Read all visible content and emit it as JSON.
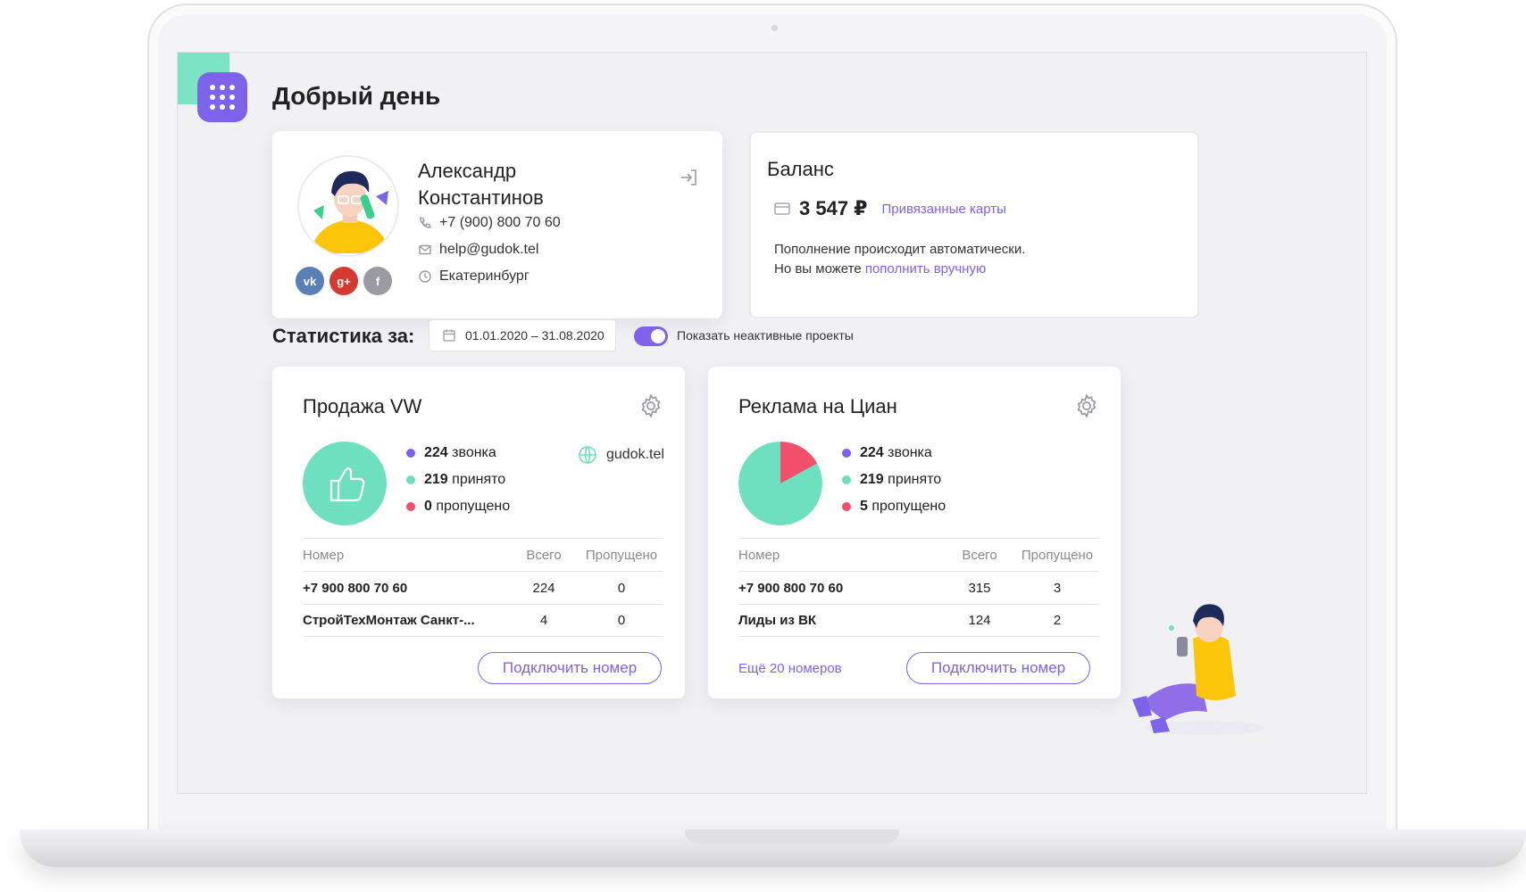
{
  "greeting": "Добрый день",
  "profile": {
    "name_line1": "Александр",
    "name_line2": "Константинов",
    "phone": "+7 (900) 800 70 60",
    "email": "help@gudok.tel",
    "city": "Екатеринбург",
    "socials": [
      {
        "icon": "vk-icon",
        "label": "vk",
        "color": "#5a7fb6"
      },
      {
        "icon": "google-plus-icon",
        "label": "g+",
        "color": "#d23a32"
      },
      {
        "icon": "facebook-icon",
        "label": "f",
        "color": "#9a9aa2"
      }
    ]
  },
  "balance": {
    "title": "Баланс",
    "amount": "3 547 ₽",
    "cards_link": "Привязанные карты",
    "text_line1": "Пополнение происходит автоматически.",
    "text_line2_prefix": "Но вы можете ",
    "text_line2_link": "пополнить вручную"
  },
  "stats": {
    "label": "Статистика за:",
    "date_range": "01.01.2020 – 31.08.2020",
    "toggle_on": true,
    "toggle_label": "Показать неактивные проекты"
  },
  "colors": {
    "accent": "#7d63ea",
    "green": "#6ee0bf",
    "red": "#f2506a"
  },
  "projects": [
    {
      "title": "Продажа VW",
      "calls_num": "224",
      "calls_text": "звонка",
      "accepted_num": "219",
      "accepted_text": "принято",
      "missed_num": "0",
      "missed_text": "пропущено",
      "missed_fraction": 0,
      "site": "gudok.tel",
      "table_head": {
        "c1": "Номер",
        "c2": "Всего",
        "c3": "Пропущено"
      },
      "rows": [
        {
          "c1": "+7 900 800 70 60",
          "c2": "224",
          "c3": "0"
        },
        {
          "c1": "СтройТехМонтаж Санкт-...",
          "c2": "4",
          "c3": "0"
        }
      ],
      "button": "Подключить номер"
    },
    {
      "title": "Реклама на Циан",
      "calls_num": "224",
      "calls_text": "звонка",
      "accepted_num": "219",
      "accepted_text": "принято",
      "missed_num": "5",
      "missed_text": "пропущено",
      "missed_fraction": 0.17,
      "table_head": {
        "c1": "Номер",
        "c2": "Всего",
        "c3": "Пропущено"
      },
      "rows": [
        {
          "c1": "+7 900 800 70 60",
          "c2": "315",
          "c3": "3"
        },
        {
          "c1": "Лиды из ВК",
          "c2": "124",
          "c3": "2"
        }
      ],
      "more_link": "Ещё 20 номеров",
      "button": "Подключить номер"
    }
  ]
}
